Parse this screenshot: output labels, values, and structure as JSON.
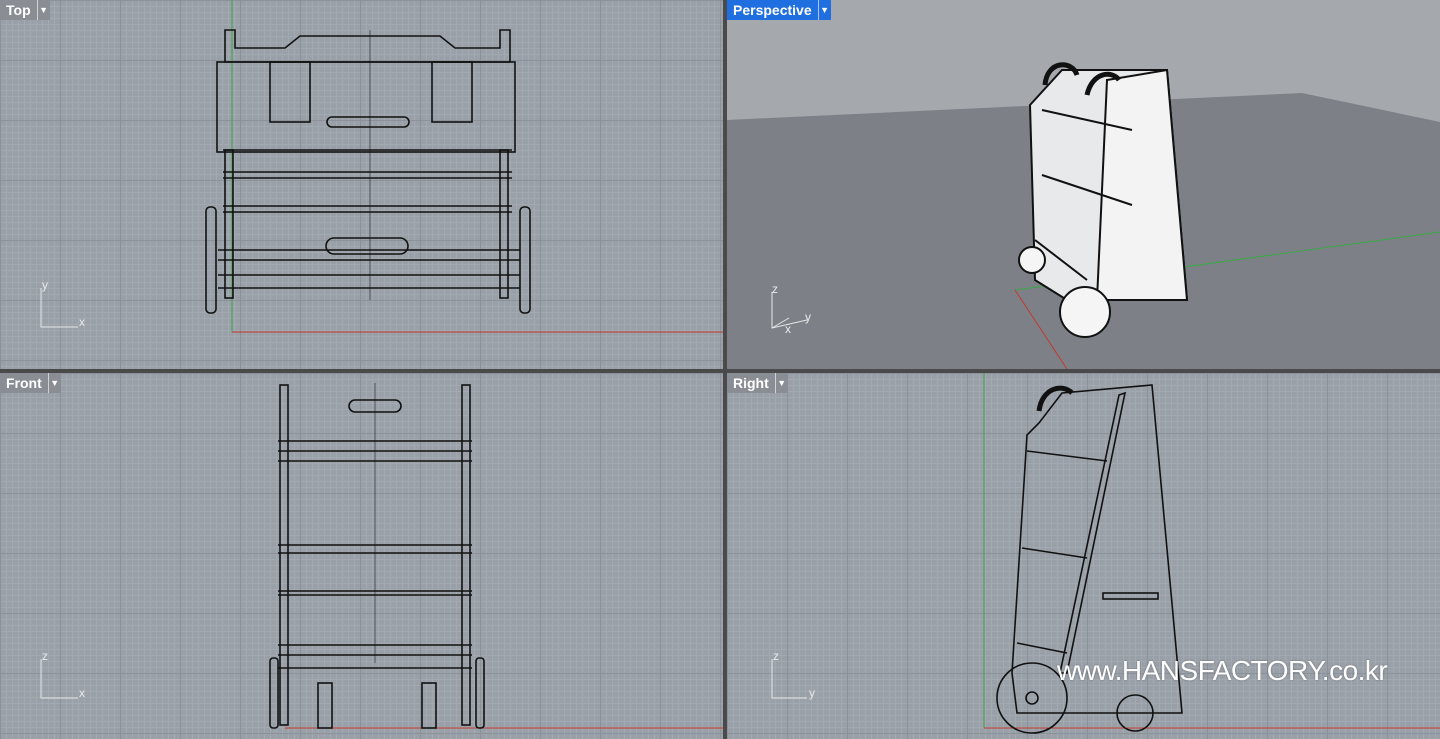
{
  "viewports": {
    "top": {
      "title": "Top",
      "axis_h": "x",
      "axis_v": "y"
    },
    "perspective": {
      "title": "Perspective",
      "axis_a": "z",
      "axis_b": "y",
      "axis_c": "x"
    },
    "front": {
      "title": "Front",
      "axis_h": "x",
      "axis_v": "z"
    },
    "right": {
      "title": "Right",
      "axis_h": "y",
      "axis_v": "z"
    }
  },
  "dropdown_icon": "caret-down",
  "watermark": "www.HANSFACTORY.co.kr",
  "colors": {
    "active_tab": "#1f6fe0",
    "x_axis": "#c0392b",
    "y_axis": "#3aa845"
  }
}
